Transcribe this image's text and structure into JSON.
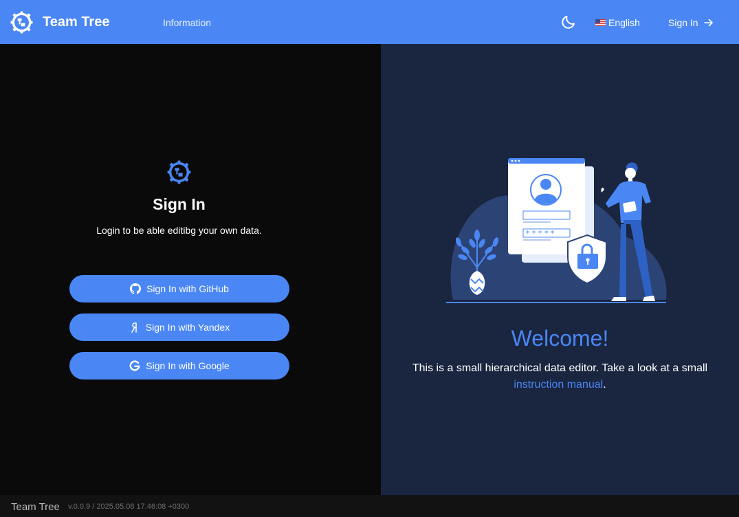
{
  "header": {
    "app_name": "Team Tree",
    "nav_information": "Information",
    "language": "English",
    "signin_label": "Sign In"
  },
  "signin": {
    "title": "Sign In",
    "subtitle": "Login to be able editibg your own data.",
    "buttons": {
      "github": "Sign In with GitHub",
      "yandex": "Sign In with Yandex",
      "google": "Sign In with Google"
    }
  },
  "welcome": {
    "title": "Welcome!",
    "text": "This is a small hierarchical data editor. Take a look at a small",
    "link": "instruction manual",
    "end": "."
  },
  "footer": {
    "name": "Team Tree",
    "version": "v.0.0.9 / 2025.05.08 17:46:08 +0300"
  },
  "colors": {
    "accent": "#4a87f5",
    "dark_panel": "#1a2540",
    "background": "#0a0a0a"
  },
  "icons": [
    "team-tree-logo-icon",
    "moon-icon",
    "us-flag-icon",
    "arrow-right-icon",
    "github-icon",
    "yandex-icon",
    "google-icon"
  ]
}
